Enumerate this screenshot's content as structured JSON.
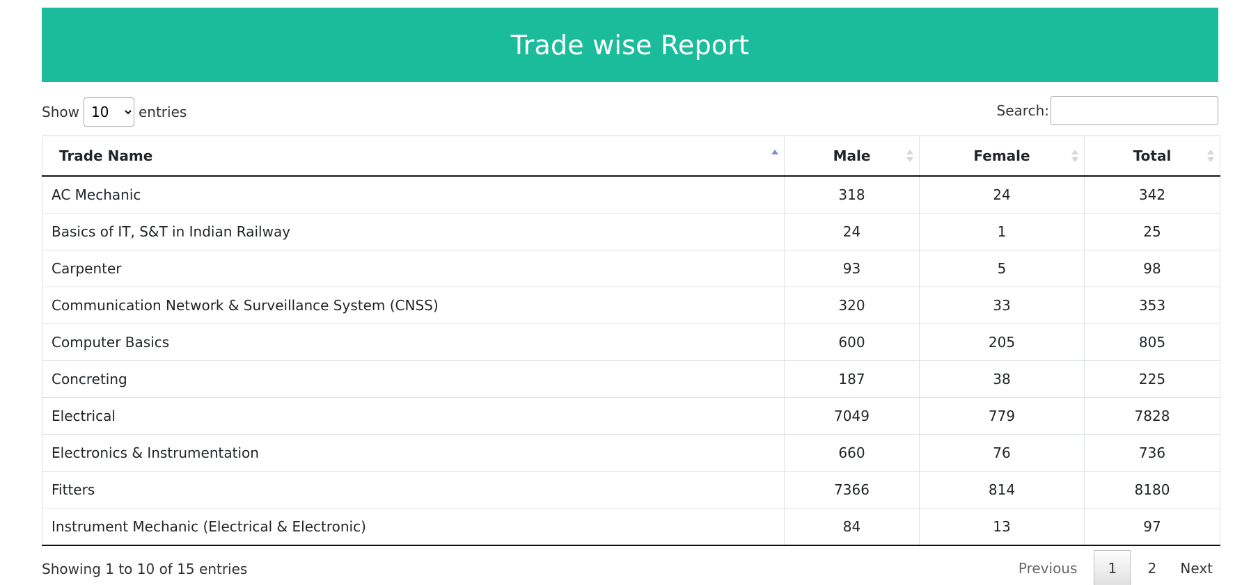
{
  "header": {
    "title": "Trade wise Report"
  },
  "length_control": {
    "show_label": "Show",
    "selected": "10",
    "entries_label": "entries"
  },
  "search": {
    "label": "Search:",
    "value": ""
  },
  "table": {
    "columns": [
      "Trade Name",
      "Male",
      "Female",
      "Total"
    ],
    "rows": [
      [
        "AC Mechanic",
        "318",
        "24",
        "342"
      ],
      [
        "Basics of IT, S&T in Indian Railway",
        "24",
        "1",
        "25"
      ],
      [
        "Carpenter",
        "93",
        "5",
        "98"
      ],
      [
        "Communication Network & Surveillance System (CNSS)",
        "320",
        "33",
        "353"
      ],
      [
        "Computer Basics",
        "600",
        "205",
        "805"
      ],
      [
        "Concreting",
        "187",
        "38",
        "225"
      ],
      [
        "Electrical",
        "7049",
        "779",
        "7828"
      ],
      [
        "Electronics & Instrumentation",
        "660",
        "76",
        "736"
      ],
      [
        "Fitters",
        "7366",
        "814",
        "8180"
      ],
      [
        "Instrument Mechanic (Electrical & Electronic)",
        "84",
        "13",
        "97"
      ]
    ]
  },
  "footer": {
    "info": "Showing 1 to 10 of 15 entries",
    "pagination": {
      "previous": "Previous",
      "pages": [
        "1",
        "2"
      ],
      "next": "Next"
    }
  },
  "colors": {
    "banner": "#1abc9c",
    "sort_active": "#7f8ad8"
  }
}
